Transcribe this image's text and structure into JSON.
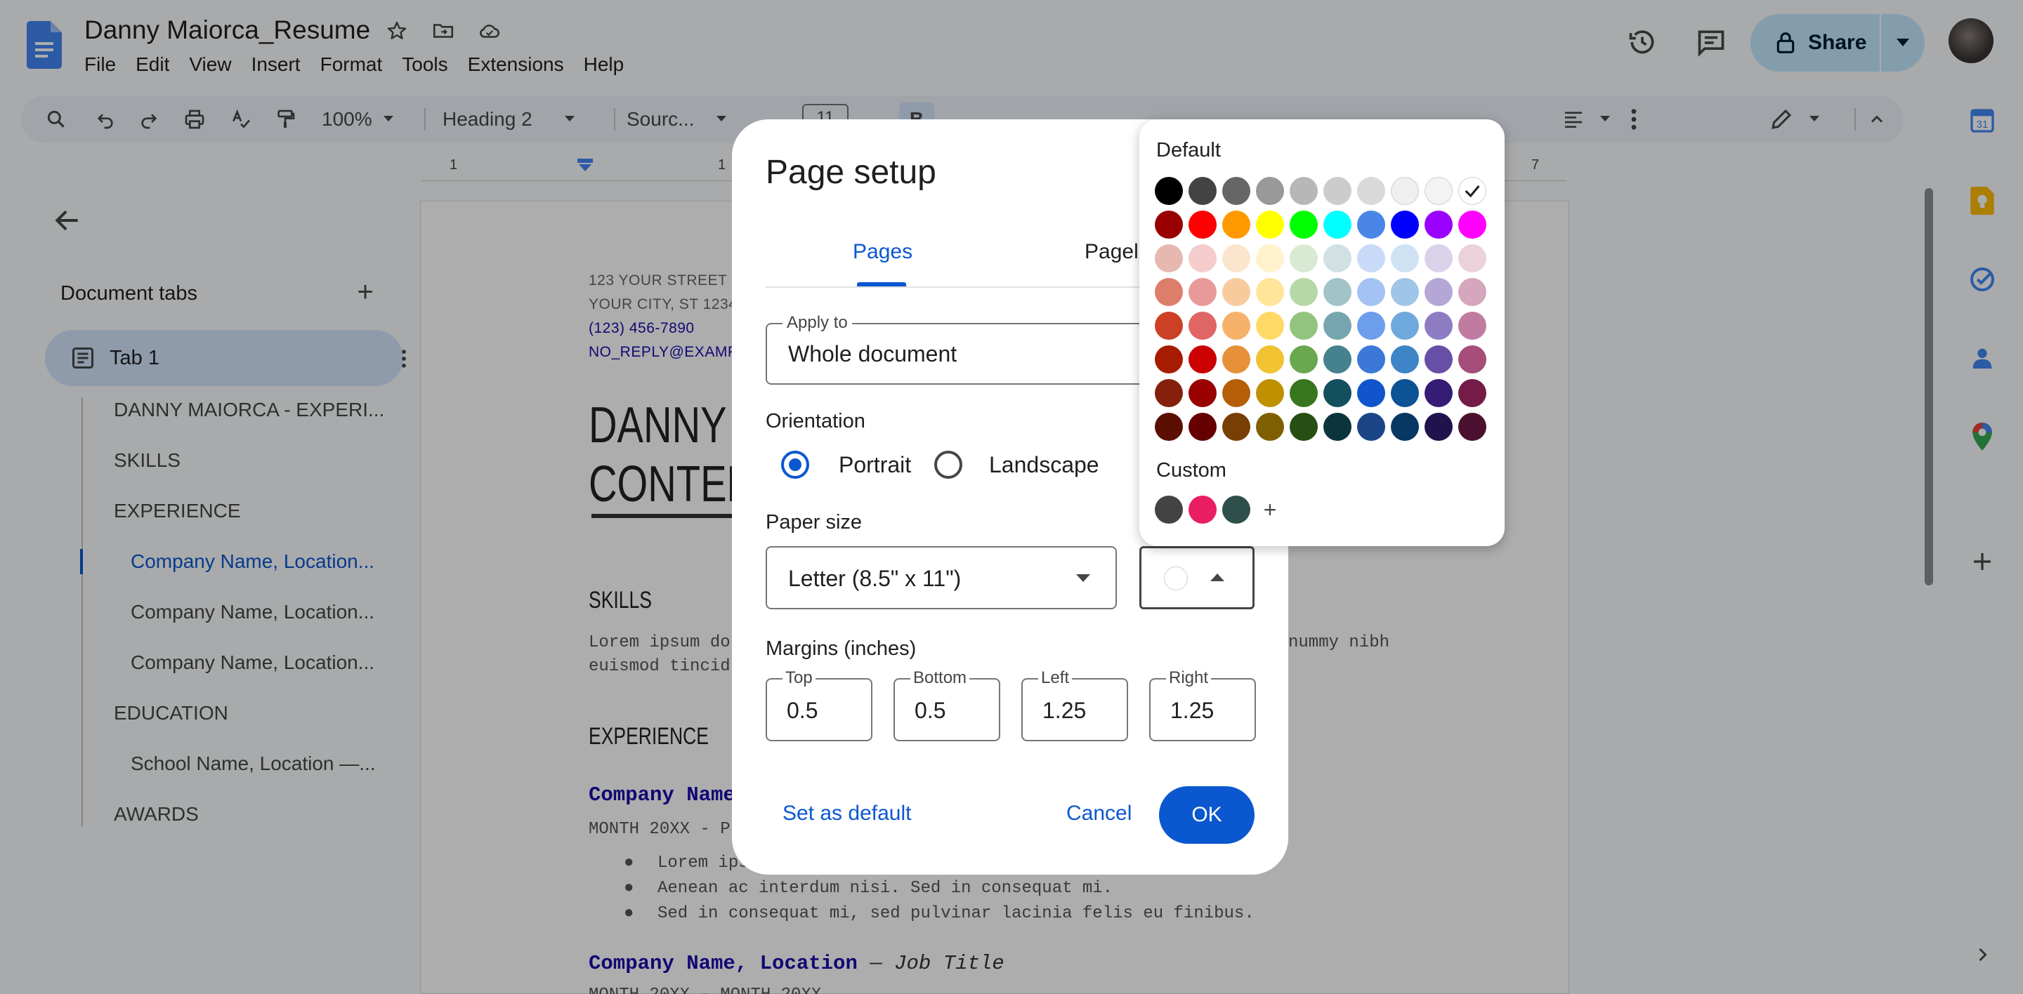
{
  "header": {
    "doc_title": "Danny Maiorca_Resume",
    "menu": [
      "File",
      "Edit",
      "View",
      "Insert",
      "Format",
      "Tools",
      "Extensions",
      "Help"
    ],
    "share_label": "Share"
  },
  "toolbar": {
    "zoom": "100%",
    "style": "Heading 2",
    "font": "Sourc...",
    "font_size": "11"
  },
  "ruler": [
    "1",
    "1",
    "7"
  ],
  "sidebar": {
    "title": "Document tabs",
    "tab_label": "Tab 1",
    "items": [
      {
        "label": "DANNY MAIORCA - EXPERI...",
        "level": 1,
        "active": false
      },
      {
        "label": "SKILLS",
        "level": 1,
        "active": false
      },
      {
        "label": "EXPERIENCE",
        "level": 1,
        "active": false
      },
      {
        "label": "Company Name, Location...",
        "level": 2,
        "active": true
      },
      {
        "label": "Company Name, Location...",
        "level": 2,
        "active": false
      },
      {
        "label": "Company Name, Location...",
        "level": 2,
        "active": false
      },
      {
        "label": "EDUCATION",
        "level": 1,
        "active": false
      },
      {
        "label": "School Name, Location —...",
        "level": 2,
        "active": false
      },
      {
        "label": "AWARDS",
        "level": 1,
        "active": false
      }
    ]
  },
  "document": {
    "address1": "123 YOUR STREET",
    "address2": "YOUR CITY, ST 12345",
    "phone": "(123) 456-7890",
    "email": "NO_REPLY@EXAMPLE",
    "name_line1": "DANNY M",
    "name_line2": "CONTENT",
    "skills_heading": "SKILLS",
    "skills_text1": "Lorem ipsum do",
    "skills_text1_right": "nummy nibh",
    "skills_text2": "euismod tincid",
    "experience_heading": "EXPERIENCE",
    "company1": "Company Name",
    "date1": "MONTH 20XX - P",
    "bullets": [
      "Lorem ips",
      "Aenean ac interdum nisi. Sed in consequat mi.",
      "Sed in consequat mi, sed pulvinar lacinia felis eu finibus."
    ],
    "company2": "Company Name, Location",
    "job_title2": " — Job Title",
    "date2": "MONTH 20XX - MONTH 20XX"
  },
  "dialog": {
    "title": "Page setup",
    "tabs": [
      "Pages",
      "Pagel"
    ],
    "apply_to_label": "Apply to",
    "apply_to_value": "Whole document",
    "orientation_label": "Orientation",
    "portrait_label": "Portrait",
    "landscape_label": "Landscape",
    "orientation_selected": "Portrait",
    "paper_size_label": "Paper size",
    "paper_size_value": "Letter (8.5\" x 11\")",
    "margins_label": "Margins (inches)",
    "margins": [
      {
        "label": "Top",
        "value": "0.5"
      },
      {
        "label": "Bottom",
        "value": "0.5"
      },
      {
        "label": "Left",
        "value": "1.25"
      },
      {
        "label": "Right",
        "value": "1.25"
      }
    ],
    "set_default_label": "Set as default",
    "cancel_label": "Cancel",
    "ok_label": "OK"
  },
  "palette": {
    "default_label": "Default",
    "custom_label": "Custom",
    "selected": "#ffffff",
    "rows": [
      [
        "#000000",
        "#434343",
        "#666666",
        "#999999",
        "#b7b7b7",
        "#cccccc",
        "#d9d9d9",
        "#efefef",
        "#f3f3f3",
        "#ffffff"
      ],
      [
        "#980000",
        "#ff0000",
        "#ff9900",
        "#ffff00",
        "#00ff00",
        "#00ffff",
        "#4a86e8",
        "#0000ff",
        "#9900ff",
        "#ff00ff"
      ],
      [
        "#e6b8af",
        "#f4cccc",
        "#fce5cd",
        "#fff2cc",
        "#d9ead3",
        "#d0e0e3",
        "#c9daf8",
        "#cfe2f3",
        "#d9d2e9",
        "#ead1dc"
      ],
      [
        "#dd7e6b",
        "#ea9999",
        "#f9cb9c",
        "#ffe599",
        "#b6d7a8",
        "#a2c4c9",
        "#a4c2f4",
        "#9fc5e8",
        "#b4a7d6",
        "#d5a6bd"
      ],
      [
        "#cc4125",
        "#e06666",
        "#f6b26b",
        "#ffd966",
        "#93c47d",
        "#76a5af",
        "#6d9eeb",
        "#6fa8dc",
        "#8e7cc3",
        "#c27ba0"
      ],
      [
        "#a61c00",
        "#cc0000",
        "#e69138",
        "#f1c232",
        "#6aa84f",
        "#45818e",
        "#3c78d8",
        "#3d85c6",
        "#674ea7",
        "#a64d79"
      ],
      [
        "#85200c",
        "#990000",
        "#b45f06",
        "#bf9000",
        "#38761d",
        "#134f5c",
        "#1155cc",
        "#0b5394",
        "#351c75",
        "#741b47"
      ],
      [
        "#5b0f00",
        "#660000",
        "#783f04",
        "#7f6000",
        "#274e13",
        "#0c343d",
        "#1c4587",
        "#073763",
        "#20124d",
        "#4c1130"
      ]
    ],
    "custom": [
      "#434343",
      "#e91e63",
      "#2f4f4a"
    ]
  },
  "colors": {
    "accent": "#0b57d0",
    "share_bg": "#c2e7ff"
  }
}
